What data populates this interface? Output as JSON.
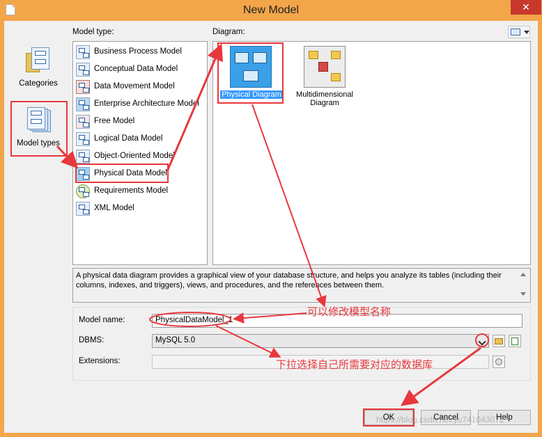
{
  "window": {
    "title": "New Model",
    "close_glyph": "✕"
  },
  "categories": [
    {
      "label": "Categories",
      "selected": false
    },
    {
      "label": "Model types",
      "selected": true
    }
  ],
  "model_type_label": "Model type:",
  "model_types": [
    {
      "label": "Business Process Model",
      "icon": "business-process-icon"
    },
    {
      "label": "Conceptual Data Model",
      "icon": "conceptual-data-icon"
    },
    {
      "label": "Data Movement Model",
      "icon": "data-movement-icon"
    },
    {
      "label": "Enterprise Architecture Model",
      "icon": "enterprise-architecture-icon"
    },
    {
      "label": "Free Model",
      "icon": "free-model-icon"
    },
    {
      "label": "Logical Data Model",
      "icon": "logical-data-icon"
    },
    {
      "label": "Object-Oriented Model",
      "icon": "object-oriented-icon"
    },
    {
      "label": "Physical Data Model",
      "icon": "physical-data-icon",
      "selected": true
    },
    {
      "label": "Requirements Model",
      "icon": "requirements-icon"
    },
    {
      "label": "XML Model",
      "icon": "xml-model-icon"
    }
  ],
  "diagram_label": "Diagram:",
  "diagrams": [
    {
      "label": "Physical Diagram",
      "selected": true
    },
    {
      "label": "Multidimensional Diagram",
      "selected": false
    }
  ],
  "description": "A physical data diagram provides a graphical view of your database structure, and helps you analyze its tables (including their columns, indexes, and triggers), views, and procedures, and the references between them.",
  "form": {
    "model_name_label": "Model name:",
    "model_name_value": "PhysicalDataModel_1",
    "dbms_label": "DBMS:",
    "dbms_value": "MySQL 5.0",
    "extensions_label": "Extensions:",
    "extensions_value": ""
  },
  "buttons": {
    "ok": "OK",
    "cancel": "Cancel",
    "help": "Help"
  },
  "annotations": {
    "rename": "可以修改模型名称",
    "dbms": "下拉选择自己所需要对应的数据库"
  },
  "watermark": "https://blog.csdn.net/yu741043072",
  "colors": {
    "title_bar": "#f3a54a",
    "selection": "#3399ff",
    "annotation": "#e8383d",
    "close": "#c7392b"
  }
}
